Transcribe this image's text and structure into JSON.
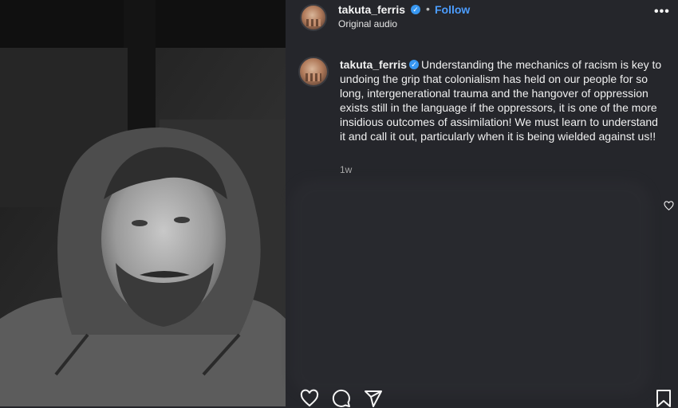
{
  "post": {
    "username": "takuta_ferris",
    "follow_label": "Follow",
    "separator": "•",
    "audio": "Original audio",
    "more_label": "•••"
  },
  "caption": {
    "username": "takuta_ferris",
    "text": "Understanding the mechanics of racism is key to undoing the grip that colonialism has held on our people for so long, intergenerational trauma and the hangover of oppression exists still in the language if the oppressors, it is one of the more insidious outcomes of assimilation! We must learn to understand it and call it out, particularly when it is being wielded against us!!",
    "time": "1w"
  },
  "colors": {
    "background": "#25262b",
    "follow": "#4c9dff",
    "verified": "#3897f0"
  },
  "icons": [
    "verified-icon",
    "more-icon",
    "heart-icon",
    "comment-icon",
    "share-icon",
    "bookmark-icon"
  ]
}
